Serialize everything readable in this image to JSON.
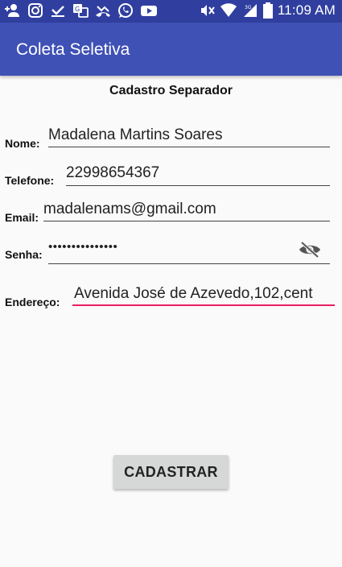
{
  "status_bar": {
    "time": "11:09 AM",
    "icons": [
      "add-person-icon",
      "instagram-icon",
      "download-done-icon",
      "translate-icon",
      "missed-call-icon",
      "whatsapp-icon",
      "youtube-icon",
      "mute-icon",
      "wifi-icon",
      "signal-3g-icon",
      "battery-icon"
    ],
    "network": "3G"
  },
  "app_bar": {
    "title": "Coleta Seletiva",
    "color": "#3F51B5",
    "status_color": "#303F9F"
  },
  "form": {
    "title": "Cadastro Separador",
    "nome": {
      "label": "Nome:",
      "value": "Madalena Martins Soares"
    },
    "telefone": {
      "label": "Telefone:",
      "value": "22998654367"
    },
    "email": {
      "label": "Email:",
      "value": "madalenams@gmail.com"
    },
    "senha": {
      "label": "Senha:",
      "value": "•••••••••••••••"
    },
    "endereco": {
      "label": "Endereço:",
      "value": "Avenida José de Azevedo,102,cent"
    },
    "accent_color": "#E91E63"
  },
  "submit_button": {
    "label": "CADASTRAR"
  }
}
